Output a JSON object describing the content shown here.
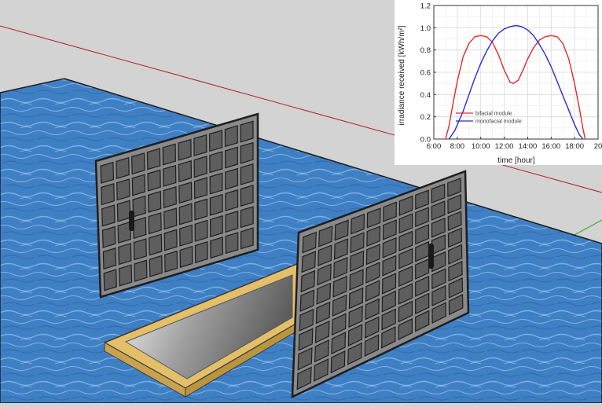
{
  "colors": {
    "background": "#d3d3d3",
    "water": "#3f7fc4",
    "panel_frame": "#2a2a2a",
    "panel_cell": "#5e5e5e",
    "reflector_frame": "#e3bf6a",
    "reflector_surface": "#9a9a9a",
    "axis_red": "#b22222",
    "axis_green": "#2faa2f",
    "bifacial": "#e8292b",
    "monofacial": "#2a2ae0",
    "grid": "#d9d9d9"
  },
  "icons": {
    "scene": "floating-bifacial-pv-scene",
    "panel": "solar-panel-icon",
    "reflector": "reflector-plate-icon",
    "junction_box": "junction-box-icon"
  },
  "chart_data": {
    "type": "line",
    "xlabel": "time [hour]",
    "ylabel": "irradiance received [kWh/m²]",
    "xlim": [
      6,
      20
    ],
    "ylim": [
      0,
      1.2
    ],
    "x_ticks": [
      6,
      8,
      10,
      12,
      14,
      16,
      18,
      20
    ],
    "x_tick_labels": [
      "6:00",
      "8:00",
      "10:00",
      "12:00",
      "14:00",
      "16:00",
      "18:00",
      "20"
    ],
    "y_ticks": [
      0,
      0.2,
      0.4,
      0.6,
      0.8,
      1.0,
      1.2
    ],
    "y_tick_labels": [
      "0.0",
      "0.2",
      "0.4",
      "0.6",
      "0.8",
      "1.0",
      "1.2"
    ],
    "grid": true,
    "legend_position": "lower-center",
    "series": [
      {
        "name": "bifacial module",
        "color": "#e8292b",
        "points": [
          [
            7.0,
            0.0
          ],
          [
            7.3,
            0.12
          ],
          [
            7.6,
            0.3
          ],
          [
            8.0,
            0.52
          ],
          [
            8.5,
            0.74
          ],
          [
            9.0,
            0.86
          ],
          [
            9.5,
            0.92
          ],
          [
            10.0,
            0.93
          ],
          [
            10.5,
            0.92
          ],
          [
            11.0,
            0.87
          ],
          [
            11.5,
            0.76
          ],
          [
            12.0,
            0.62
          ],
          [
            12.5,
            0.51
          ],
          [
            12.8,
            0.5
          ],
          [
            13.2,
            0.53
          ],
          [
            13.6,
            0.62
          ],
          [
            14.0,
            0.72
          ],
          [
            14.5,
            0.82
          ],
          [
            15.0,
            0.89
          ],
          [
            15.5,
            0.92
          ],
          [
            16.0,
            0.93
          ],
          [
            16.5,
            0.92
          ],
          [
            17.0,
            0.86
          ],
          [
            17.5,
            0.72
          ],
          [
            18.0,
            0.5
          ],
          [
            18.4,
            0.28
          ],
          [
            18.7,
            0.1
          ],
          [
            18.9,
            0.0
          ]
        ]
      },
      {
        "name": "monofacial module",
        "color": "#2a2ae0",
        "points": [
          [
            7.3,
            0.0
          ],
          [
            7.8,
            0.08
          ],
          [
            8.5,
            0.25
          ],
          [
            9.0,
            0.4
          ],
          [
            9.5,
            0.55
          ],
          [
            10.0,
            0.68
          ],
          [
            10.5,
            0.79
          ],
          [
            11.0,
            0.88
          ],
          [
            11.5,
            0.95
          ],
          [
            12.0,
            0.99
          ],
          [
            12.5,
            1.01
          ],
          [
            13.0,
            1.02
          ],
          [
            13.5,
            1.01
          ],
          [
            14.0,
            0.98
          ],
          [
            14.5,
            0.93
          ],
          [
            15.0,
            0.85
          ],
          [
            15.5,
            0.76
          ],
          [
            16.0,
            0.65
          ],
          [
            16.5,
            0.52
          ],
          [
            17.0,
            0.39
          ],
          [
            17.5,
            0.26
          ],
          [
            18.0,
            0.13
          ],
          [
            18.4,
            0.04
          ],
          [
            18.7,
            0.0
          ]
        ]
      }
    ]
  }
}
